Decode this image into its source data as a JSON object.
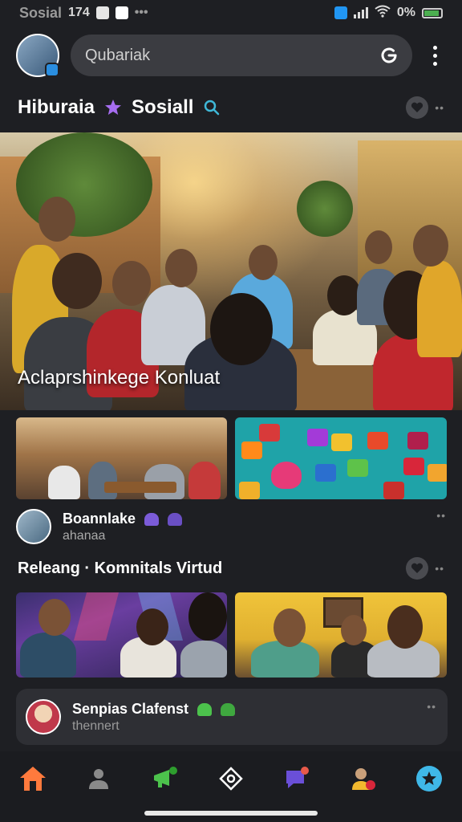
{
  "status_bar": {
    "app_name": "Sosial",
    "time": "174",
    "battery_text": "0%",
    "icons": [
      "notification-icon",
      "check-icon",
      "bluetooth-icon",
      "signal-icon",
      "wifi-icon",
      "battery-icon"
    ]
  },
  "header": {
    "search_placeholder": "Qubariak",
    "search_action_icon": "google-g-icon",
    "menu_icon": "more-vertical-icon"
  },
  "section_1": {
    "title_left": "Hiburaia",
    "separator_icon": "star-icon",
    "title_right": "Sosiall",
    "search_icon": "search-icon"
  },
  "hero": {
    "caption": "Aclaprshinkege Konluat"
  },
  "post": {
    "name": "Boannlake",
    "sub": "ahanaa"
  },
  "section_2": {
    "title": "Releang · Komnitals Virtud"
  },
  "card": {
    "name": "Senpias Clafenst",
    "sub": "thennert"
  },
  "nav": {
    "items": [
      "home-icon",
      "users-icon",
      "megaphone-icon",
      "compass-icon",
      "chat-icon",
      "profile-icon",
      "star-badge-icon"
    ]
  },
  "colors": {
    "background": "#1e1f23",
    "accent_purple": "#a66df0",
    "accent_teal": "#3fb8d8",
    "home_orange": "#ff7a3d"
  }
}
